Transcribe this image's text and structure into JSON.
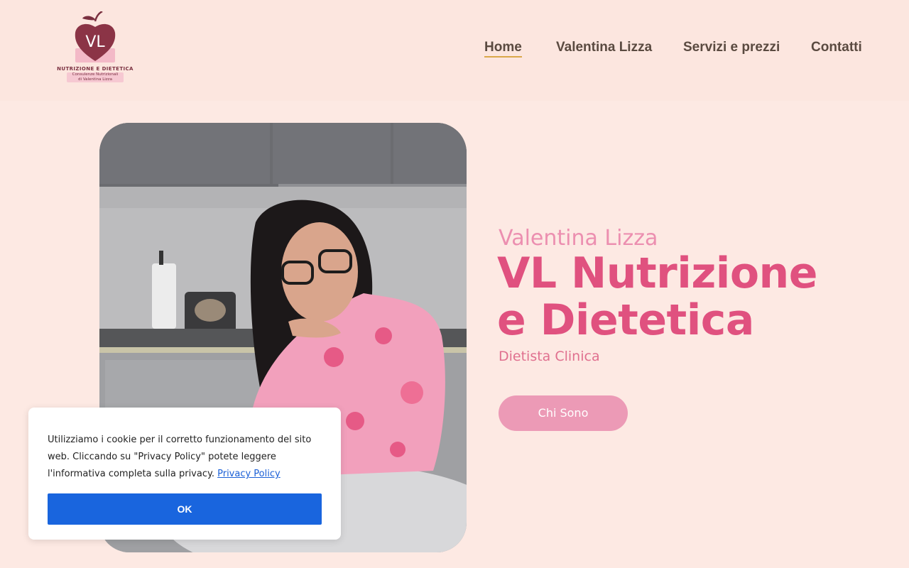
{
  "logo": {
    "initials": "VL",
    "title": "NUTRIZIONE E DIETETICA",
    "subtitle_line1": "Consulenze Nutrizionali",
    "subtitle_line2": "di Valentina Lizza"
  },
  "nav": {
    "items": [
      {
        "label": "Home",
        "active": true
      },
      {
        "label": "Valentina Lizza",
        "active": false
      },
      {
        "label": "Servizi e prezzi",
        "active": false
      },
      {
        "label": "Contatti",
        "active": false
      }
    ]
  },
  "hero": {
    "eyebrow": "Valentina Lizza",
    "title_line1": "VL Nutrizione",
    "title_line2": "e Dietetica",
    "subtitle": "Dietista Clinica",
    "cta_label": "Chi Sono"
  },
  "cookie": {
    "text": "Utilizziamo i cookie per il corretto funzionamento del sito web. Cliccando su \"Privacy Policy\" potete leggere l'informativa completa sulla privacy.",
    "link_label": "Privacy Policy",
    "ok_label": "OK"
  },
  "colors": {
    "background": "#fde9e3",
    "header": "#fce6df",
    "accent_pink": "#e0517f",
    "button_pink": "#ec9ab6",
    "nav_underline": "#d9a84a",
    "cookie_button": "#1965de"
  }
}
